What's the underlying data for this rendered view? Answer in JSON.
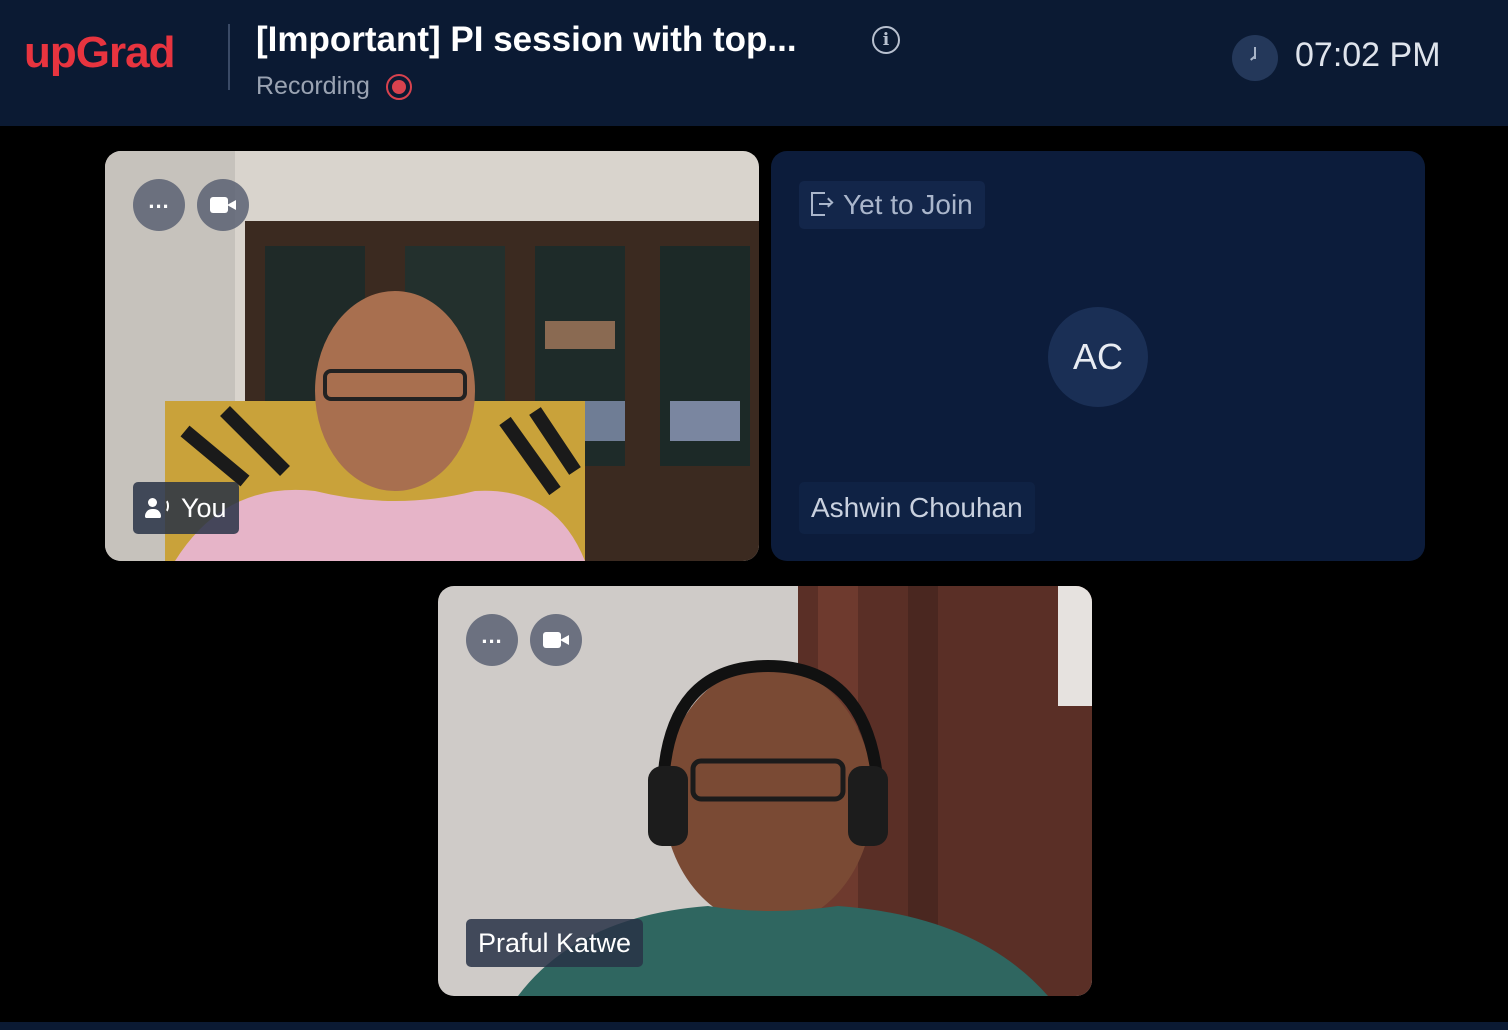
{
  "header": {
    "logo": "upGrad",
    "meeting_title": "[Important] PI session with top...",
    "recording_label": "Recording",
    "time": "07:02 PM"
  },
  "tiles": [
    {
      "name": "You",
      "type": "video",
      "speaking": true
    },
    {
      "name": "Ashwin Chouhan",
      "type": "pending",
      "status": "Yet to Join",
      "initials": "AC"
    },
    {
      "name": "Praful Katwe",
      "type": "video"
    }
  ],
  "colors": {
    "brand": "#e8343f",
    "header_bg": "#0b1a33",
    "pending_tile_bg": "#0c1c3b",
    "recording": "#d8424e"
  }
}
